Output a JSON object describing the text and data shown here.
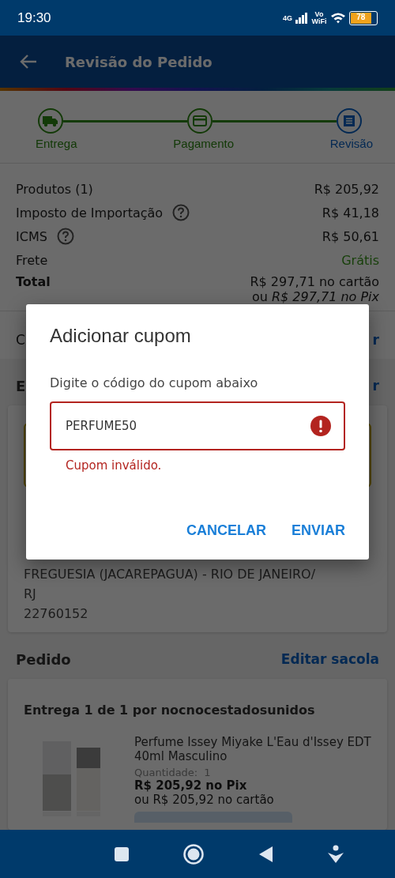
{
  "status_bar": {
    "time": "19:30",
    "network": "4G",
    "vowifi": "Vo WiFi",
    "battery": "78"
  },
  "app_bar": {
    "title": "Revisão do Pedido"
  },
  "steps": [
    {
      "label": "Entrega",
      "current": false
    },
    {
      "label": "Pagamento",
      "current": false
    },
    {
      "label": "Revisão",
      "current": true
    }
  ],
  "summary": {
    "rows": [
      {
        "label": "Produtos (1)",
        "value": "R$ 205,92",
        "help": false,
        "free": false
      },
      {
        "label": "Imposto de Importação",
        "value": "R$ 41,18",
        "help": true,
        "free": false
      },
      {
        "label": "ICMS",
        "value": "R$ 50,61",
        "help": true,
        "free": false
      },
      {
        "label": "Frete",
        "value": "Grátis",
        "help": false,
        "free": true
      }
    ],
    "total_label": "Total",
    "total_card": "R$ 297,71 no cartão",
    "total_pix": "ou *R$ 297,71 no Pix*"
  },
  "coupon_row": {
    "label_fragment": "C",
    "action_fragment": "r"
  },
  "address": {
    "title_fragment": "E",
    "action_fragment": "r",
    "lines": [
      "FREGUESIA (JACAREPAGUA) - RIO DE JANEIRO/",
      "RJ",
      "22760152"
    ]
  },
  "order": {
    "title": "Pedido",
    "action": "Editar sacola",
    "shipment": "Entrega 1 de 1 por nocnocestadosunidos",
    "item": {
      "name": "Perfume Issey Miyake L'Eau d'Issey EDT 40ml Masculino",
      "quantity_label": "Quantidade:",
      "quantity": "1",
      "price_pix": "R$ 205,92 no Pix",
      "price_card": "ou R$ 205,92 no cartão"
    }
  },
  "dialog": {
    "title": "Adicionar cupom",
    "prompt": "Digite o código do cupom abaixo",
    "value": "PERFUME50",
    "error": true,
    "error_text": "Cupom inválido.",
    "buttons": [
      "CANCELAR",
      "ENVIAR"
    ]
  }
}
